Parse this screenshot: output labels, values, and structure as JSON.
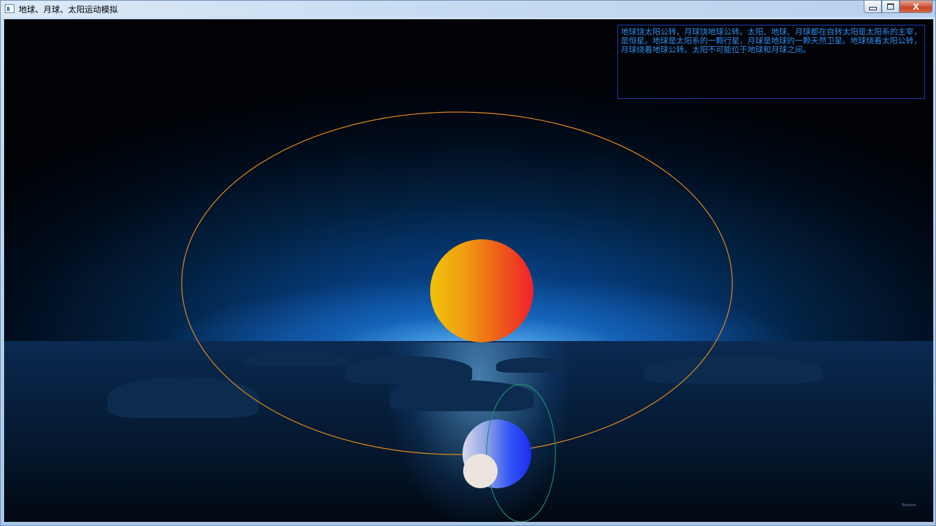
{
  "window": {
    "title": "地球、月球、太阳运动模拟",
    "controls": {
      "close_label": "X"
    }
  },
  "info_panel": {
    "text": "地球饶太阳公转，月球饶地球公转。太阳、地球、月球都在自转太阳是太阳系的主宰，是恒星。地球是太阳系的一颗行星，月球是地球的一颗天然卫星。地球绕着太阳公转，月球绕着地球公转。太阳不可能位于地球和月球之间。"
  },
  "watermark": {
    "text": "Skybase"
  },
  "colors": {
    "info_text": "#2e8ff0",
    "info_border": "#1f3fc0",
    "earth_orbit": "#e58a1c",
    "moon_orbit": "#1d8f6a",
    "sun_gradient": [
      "#f2c20a",
      "#ef9b12",
      "#ee6018",
      "#f0202a"
    ],
    "earth_gradient": [
      "#d8d8e8",
      "#8da2e8",
      "#3052f4",
      "#1b2cf0"
    ],
    "moon_color": "#ece4dc"
  },
  "icons": {
    "app": "window-app-icon",
    "minimize": "minimize-icon",
    "maximize": "maximize-icon",
    "close": "close-icon"
  }
}
